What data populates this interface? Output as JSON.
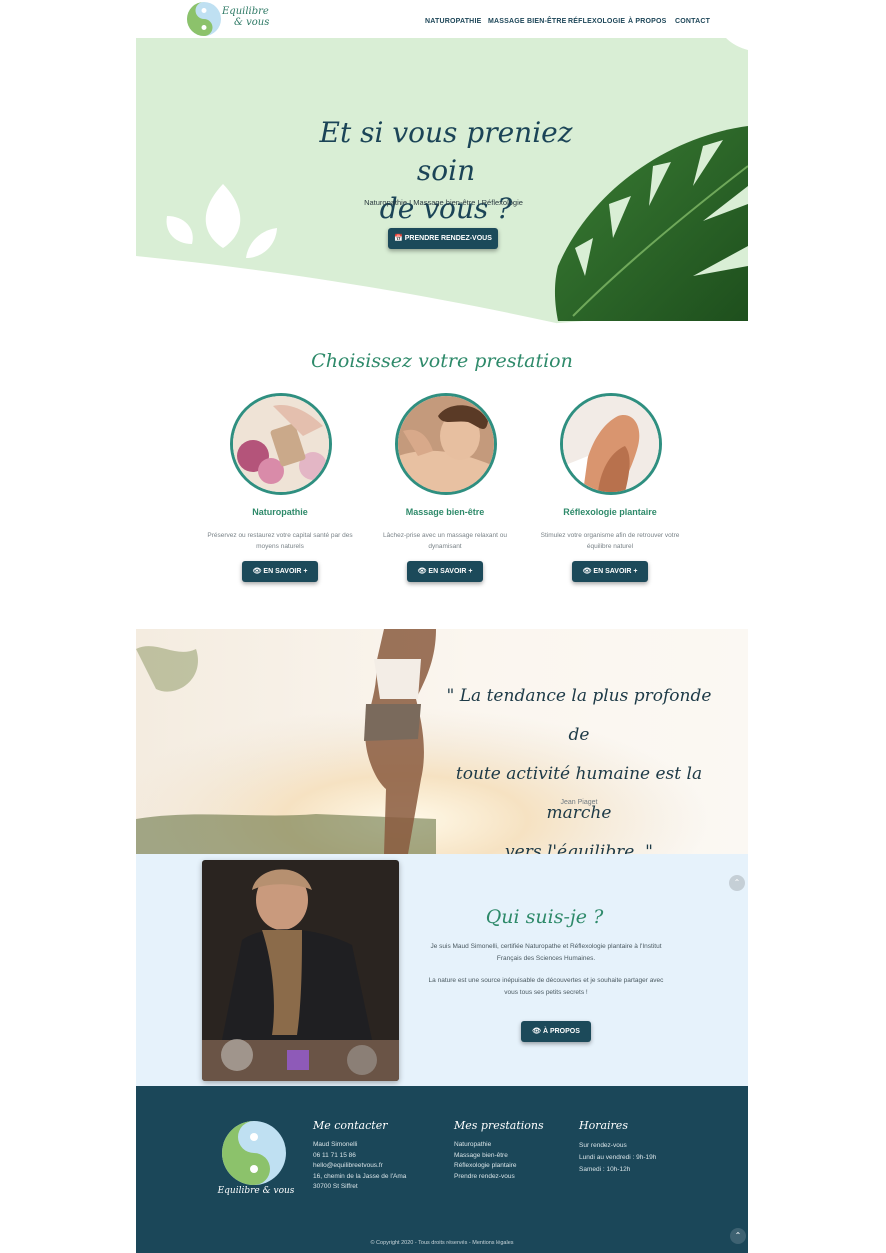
{
  "header": {
    "logo_line1": "Equilibre",
    "logo_line2": "& vous",
    "nav": [
      "NATUROPATHIE",
      "MASSAGE BIEN-ÊTRE",
      "RÉFLEXOLOGIE",
      "À PROPOS",
      "CONTACT"
    ]
  },
  "hero": {
    "title_line1": "Et si vous preniez soin",
    "title_line2": "de vous ?",
    "subtitle": "Naturopathie I Massage bien-être I Réflexologie",
    "button": "PRENDRE RENDEZ-VOUS"
  },
  "services": {
    "title": "Choisissez votre prestation",
    "items": [
      {
        "name": "Naturopathie",
        "desc": "Préservez ou restaurez votre capital santé par des moyens naturels",
        "button": "EN SAVOIR +"
      },
      {
        "name": "Massage bien-être",
        "desc": "Lâchez-prise avec un massage relaxant ou dynamisant",
        "button": "EN SAVOIR +"
      },
      {
        "name": "Réflexologie plantaire",
        "desc": "Stimulez votre organisme afin de retrouver votre équilibre naturel",
        "button": "EN SAVOIR +"
      }
    ]
  },
  "quote": {
    "line1": "\" La tendance la plus profonde de",
    "line2": "toute activité humaine est la marche",
    "line3": "vers l'équilibre. \"",
    "author": "Jean Piaget"
  },
  "about": {
    "title": "Qui suis-je ?",
    "p1": "Je suis Maud Simonelli, certifiée Naturopathe et Réflexologie plantaire à l'Institut Français des Sciences Humaines.",
    "p2": "La nature est une source inépuisable de découvertes et je souhaite partager avec vous tous ses petits secrets !",
    "button": "À PROPOS"
  },
  "footer": {
    "logo_text": "Equilibre & vous",
    "contact": {
      "title": "Me contacter",
      "lines": [
        "Maud Simonelli",
        "06 11 71 15 86",
        "hello@equilibreetvous.fr",
        "16, chemin de la Jasse de l'Ama",
        "30700 St Siffret"
      ]
    },
    "services": {
      "title": "Mes prestations",
      "lines": [
        "Naturopathie",
        "Massage bien-être",
        "Réflexologie plantaire",
        "Prendre rendez-vous"
      ]
    },
    "hours": {
      "title": "Horaires",
      "lines": [
        "Sur rendez-vous",
        "Lundi au vendredi : 9h-19h",
        "Samedi : 10h-12h"
      ]
    },
    "copyright": "© Copyright 2020 - Tous droits réservés - Mentions légales"
  },
  "colors": {
    "accent_dark": "#1c4a5a",
    "accent_green": "#2e8a6a",
    "hero_bg": "#d9eed5",
    "about_bg": "#e6f2fb",
    "footer_bg": "#1b4759"
  },
  "icons": [
    "calendar-icon",
    "eye-icon",
    "chevron-up-icon"
  ]
}
